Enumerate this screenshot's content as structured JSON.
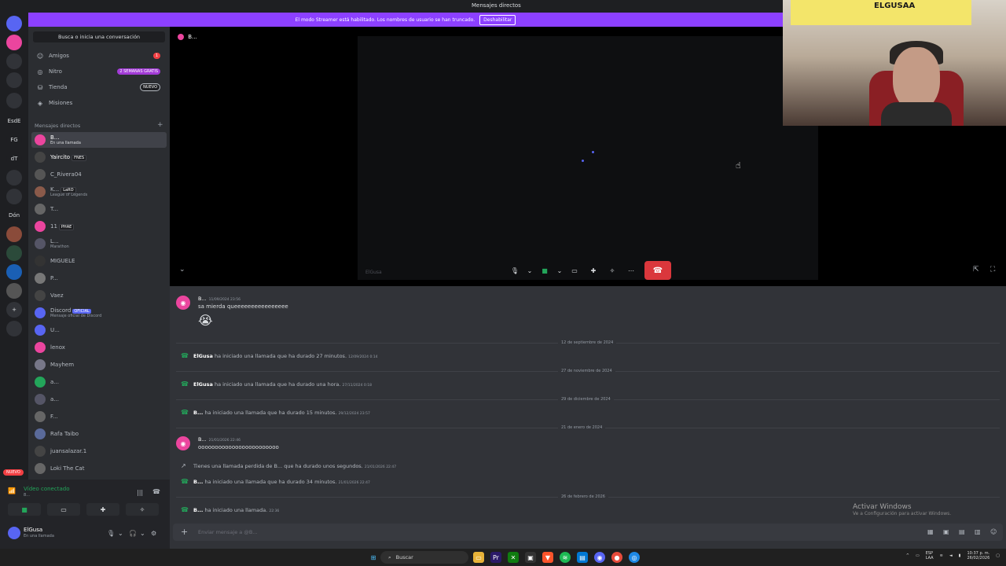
{
  "window": {
    "title": "Mensajes directos"
  },
  "banner": {
    "text": "El modo Streamer está habilitado. Los nombres de usuario se han truncado.",
    "button": "Deshabilitar"
  },
  "rail": {
    "items": [
      {
        "label": "",
        "icon": "discord-home-icon"
      },
      {
        "label": "",
        "icon": "discord-server-icon"
      },
      {
        "label": "",
        "icon": "server-avatar-icon"
      },
      {
        "label": "",
        "icon": "server-avatar-icon"
      },
      {
        "label": "",
        "icon": "server-avatar-icon"
      },
      {
        "label": "EsdE",
        "icon": ""
      },
      {
        "label": "FG",
        "icon": ""
      },
      {
        "label": "dT",
        "icon": ""
      },
      {
        "label": "",
        "icon": "server-avatar-icon"
      },
      {
        "label": "",
        "icon": "server-avatar-icon"
      },
      {
        "label": "Dón",
        "icon": ""
      },
      {
        "label": "",
        "icon": "server-avatar-icon"
      },
      {
        "label": "",
        "icon": "server-avatar-icon"
      },
      {
        "label": "",
        "icon": "server-avatar-icon"
      },
      {
        "label": "",
        "icon": "server-avatar-icon"
      },
      {
        "label": "+",
        "icon": "add-server-icon"
      },
      {
        "label": "",
        "icon": "explore-icon"
      }
    ],
    "nuevo": "NUEVO"
  },
  "sidebar": {
    "search": "Busca o inicia una conversación",
    "nav": [
      {
        "label": "Amigos",
        "icon": "friends-icon",
        "badge": "1",
        "badge_color": "#f23f43"
      },
      {
        "label": "Nitro",
        "icon": "nitro-icon",
        "badge": "2 SEMANAS GRATIS",
        "badge_color": "#a23bd6"
      },
      {
        "label": "Tienda",
        "icon": "shop-icon",
        "badge": "NUEVO",
        "badge_color": "#1e1f22"
      },
      {
        "label": "Misiones",
        "icon": "quests-icon",
        "badge": "",
        "badge_color": ""
      }
    ],
    "dm_header": "Mensajes directos",
    "dms": [
      {
        "name": "B...",
        "sub": "En una llamada",
        "tag": ""
      },
      {
        "name": "Yaircito",
        "sub": "",
        "tag": "FNES"
      },
      {
        "name": "C_Rivera04",
        "sub": "",
        "tag": ""
      },
      {
        "name": "K...",
        "sub": "League of Legends",
        "tag": "LaRO"
      },
      {
        "name": "T...",
        "sub": "",
        "tag": ""
      },
      {
        "name": "11",
        "sub": "",
        "tag": "PHAE"
      },
      {
        "name": "L...",
        "sub": "Marathon",
        "tag": ""
      },
      {
        "name": "MIGUELE",
        "sub": "",
        "tag": ""
      },
      {
        "name": "P...",
        "sub": "",
        "tag": ""
      },
      {
        "name": "Vaez",
        "sub": "",
        "tag": ""
      },
      {
        "name": "Discord",
        "sub": "Mensaje oficial de Discord",
        "tag": "OFICIAL"
      },
      {
        "name": "U...",
        "sub": "",
        "tag": ""
      },
      {
        "name": "lenox",
        "sub": "",
        "tag": ""
      },
      {
        "name": "Mayhem",
        "sub": "",
        "tag": ""
      },
      {
        "name": "a...",
        "sub": "",
        "tag": ""
      },
      {
        "name": "a...",
        "sub": "",
        "tag": ""
      },
      {
        "name": "F...",
        "sub": "",
        "tag": ""
      },
      {
        "name": "Rafa Taibo",
        "sub": "",
        "tag": ""
      },
      {
        "name": "juansalazar.1",
        "sub": "",
        "tag": ""
      },
      {
        "name": "Loki The Cat",
        "sub": "",
        "tag": ""
      }
    ]
  },
  "voice_panel": {
    "status": "Vídeo conectado",
    "sub": "8..."
  },
  "user": {
    "name": "ElGusa",
    "status": "En una llamada"
  },
  "call": {
    "title": "B...",
    "tile_name": "ElGusa"
  },
  "webcam": {
    "poster_text": "ELGUSAA"
  },
  "messages": [
    {
      "author": "B...",
      "timestamp": "11/09/2024 23:56",
      "text": "sa mierda queeeeeeeeeeeeeeee",
      "emoji": "😭"
    }
  ],
  "calls_log": [
    {
      "divider": "12 de septiembre de 2024"
    },
    {
      "who": "ElGusa",
      "text": " ha iniciado una llamada que ha durado 27 minutos.",
      "ts": "12/09/2024 0:14",
      "missed": false
    },
    {
      "divider": "27 de noviembre de 2024"
    },
    {
      "who": "ElGusa",
      "text": " ha iniciado una llamada que ha durado una hora.",
      "ts": "27/11/2024 0:18",
      "missed": false
    },
    {
      "divider": "29 de diciembre de 2024"
    },
    {
      "who": "B...",
      "text": " ha iniciado una llamada que ha durado 15 minutos.",
      "ts": "29/12/2024 23:57",
      "missed": false
    },
    {
      "divider": "21 de enero de 2024"
    }
  ],
  "message2": {
    "author": "B...",
    "timestamp": "21/01/2026 22:46",
    "text": "oooooooooooooooooooooooo"
  },
  "calls_log2": [
    {
      "who": "",
      "text": "Tienes una llamada perdida de B... que ha durado unos segundos.",
      "ts": "21/01/2026 22:47",
      "missed": true
    },
    {
      "who": "B...",
      "text": " ha iniciado una llamada que ha durado 34 minutos.",
      "ts": "21/01/2026 22:47",
      "missed": false
    },
    {
      "divider": "26 de febrero de 2026"
    },
    {
      "who": "B...",
      "text": " ha iniciado una llamada.",
      "ts": "22:36",
      "missed": false
    }
  ],
  "composer": {
    "placeholder": "Enviar mensaje a @B..."
  },
  "activate": {
    "title": "Activar Windows",
    "sub": "Ve a Configuración para activar Windows."
  },
  "taskbar": {
    "search": "Buscar",
    "lang": "ESP",
    "lang2": "LAA",
    "time": "10:37 p. m.",
    "date": "26/02/2026"
  }
}
